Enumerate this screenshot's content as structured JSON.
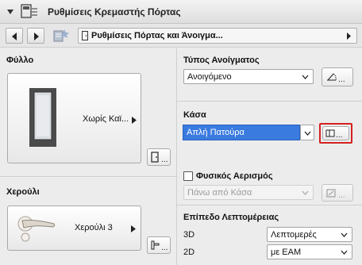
{
  "panel": {
    "title": "Ρυθμίσεις Κρεμαστής Πόρτας"
  },
  "nav": {
    "path_label": "Ρυθμίσεις Πόρτας και Άνοιγμα..."
  },
  "leaf": {
    "header": "Φύλλο",
    "preview_label": "Χωρίς Καϊ..."
  },
  "handle": {
    "header": "Χερούλι",
    "preview_label": "Χερούλι 3"
  },
  "opening_type": {
    "header": "Τύπος Ανοίγματος",
    "value": "Ανοιγόμενο"
  },
  "frame": {
    "header": "Κάσα",
    "value": "Απλή Πατούρα"
  },
  "ventilation": {
    "label": "Φυσικός Αερισμός",
    "checked": false,
    "value": "Πάνω από Κάσα"
  },
  "detail": {
    "header": "Επίπεδο Λεπτομέρειας",
    "rows": [
      {
        "label": "3D",
        "value": "Λεπτομερές"
      },
      {
        "label": "2D",
        "value": "με ΕΑΜ"
      }
    ]
  },
  "colors": {
    "selection": "#3a7be0",
    "highlight_border": "#d42020"
  }
}
